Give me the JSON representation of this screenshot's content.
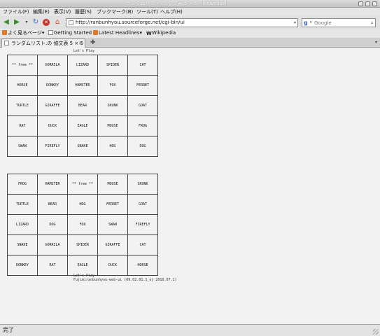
{
  "window": {
    "title": "ランダムリスト.の 協文表 5 × 5 - Iceweasel"
  },
  "menu": [
    "ファイル(F)",
    "編集(E)",
    "表示(V)",
    "履歴(S)",
    "ブックマーク(B)",
    "ツール(T)",
    "ヘルプ(H)"
  ],
  "nav": {
    "url": "http://ranbunhyou.sourceforge.net/cgi-bin/ui",
    "search_placeholder": "Google"
  },
  "bookmarks": [
    "よく見るページ▾",
    "Getting Started",
    "Latest Headlines▾",
    "Wikipedia"
  ],
  "tab": {
    "label": "ランダムリスト.の 協文表 5 × 5"
  },
  "page": {
    "caption_top": "Let's Play",
    "caption_bottom": "Let's Play",
    "footer": "Fujimiranbunhyou-web-ui (09.02.01.1_ej 2010.07.1)",
    "card1": [
      [
        "** free **",
        "GORRILA",
        "LIZARD",
        "SPIDER",
        "CAT"
      ],
      [
        "HORSE",
        "DONKEY",
        "HAMSTER",
        "FOX",
        "FERRET"
      ],
      [
        "TURTLE",
        "GIRAFFE",
        "BEAR",
        "SKUNK",
        "GOAT"
      ],
      [
        "RAT",
        "DUCK",
        "EAGLE",
        "MOUSE",
        "FROG"
      ],
      [
        "SWAN",
        "FIREFLY",
        "SNAKE",
        "HOG",
        "DOG"
      ]
    ],
    "card2": [
      [
        "FROG",
        "HAMSTER",
        "** free **",
        "MOUSE",
        "SKUNK"
      ],
      [
        "TURTLE",
        "BEAR",
        "HOG",
        "FERRET",
        "GOAT"
      ],
      [
        "LIZARD",
        "DOG",
        "FOX",
        "SWAN",
        "FIREFLY"
      ],
      [
        "SNAKE",
        "GORRILA",
        "SPIDER",
        "GIRAFFE",
        "CAT"
      ],
      [
        "DONKEY",
        "RAT",
        "EAGLE",
        "DUCK",
        "HORSE"
      ]
    ]
  },
  "status": {
    "text": "完了"
  }
}
